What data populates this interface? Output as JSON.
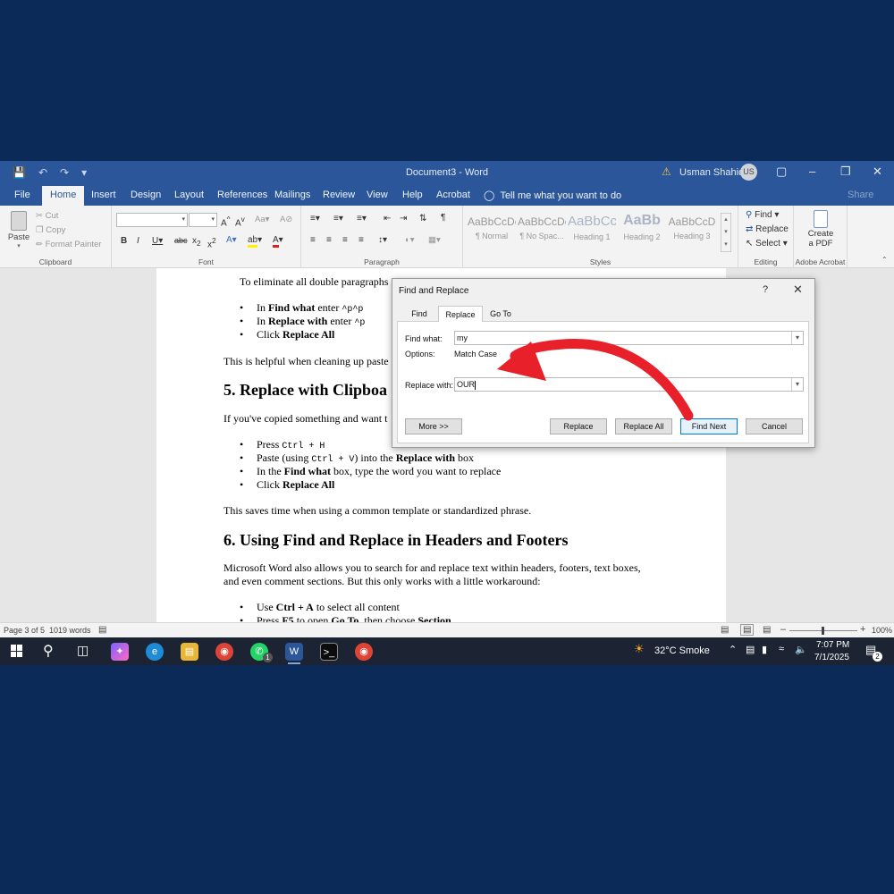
{
  "app": {
    "doc_title": "Document3 - Word",
    "user_name": "Usman Shahid",
    "user_initials": "US"
  },
  "tabs": [
    "File",
    "Home",
    "Insert",
    "Design",
    "Layout",
    "References",
    "Mailings",
    "Review",
    "View",
    "Help",
    "Acrobat"
  ],
  "tell_me": "Tell me what you want to do",
  "share": "Share",
  "ribbon": {
    "clipboard": {
      "label": "Clipboard",
      "paste": "Paste",
      "cut": "Cut",
      "copy": "Copy",
      "format_painter": "Format Painter"
    },
    "font": {
      "label": "Font"
    },
    "paragraph": {
      "label": "Paragraph"
    },
    "styles": {
      "label": "Styles",
      "items": [
        {
          "sample": "AaBbCcDc",
          "name": "¶ Normal"
        },
        {
          "sample": "AaBbCcDc",
          "name": "¶ No Spac..."
        },
        {
          "sample": "AaBbCc",
          "name": "Heading 1"
        },
        {
          "sample": "AaBb",
          "name": "Heading 2"
        },
        {
          "sample": "AaBbCcD",
          "name": "Heading 3"
        }
      ]
    },
    "editing": {
      "label": "Editing",
      "find": "Find",
      "replace": "Replace",
      "select": "Select"
    },
    "acrobat": {
      "label": "Adobe Acrobat",
      "create_pdf_1": "Create",
      "create_pdf_2": "a PDF"
    }
  },
  "document": {
    "line1": "To eliminate all double paragraphs",
    "b1_pre": "In ",
    "b1_bold": "Find what",
    "b1_post": " enter ",
    "b1_code": "^p^p",
    "b2_pre": "In ",
    "b2_bold": "Replace with",
    "b2_post": " enter ",
    "b2_code": "^p",
    "b3_pre": "Click ",
    "b3_bold": "Replace All",
    "para2": "This is helpful when cleaning up paste",
    "heading5": "5. Replace with Clipboa",
    "para3": "If you've copied something and want t",
    "c1_pre": "Press ",
    "c1_code": "Ctrl + H",
    "c2_pre": "Paste (using ",
    "c2_code": "Ctrl + V",
    "c2_mid": ") into the ",
    "c2_bold": "Replace with",
    "c2_post": " box",
    "c3_pre": "In the ",
    "c3_bold": "Find what",
    "c3_post": " box, type the word you want to replace",
    "c4_pre": "Click ",
    "c4_bold": "Replace All",
    "para4": "This saves time when using a common template or standardized phrase.",
    "heading6": "6. Using Find and Replace in Headers and Footers",
    "para5a": "Microsoft Word also allows you to search for and replace text within headers, footers, text boxes,",
    "para5b": "and even comment sections. But this only works with a little workaround:",
    "d1_pre": "Use ",
    "d1_bold": "Ctrl + A",
    "d1_post": " to select all content",
    "d2_pre": "Press ",
    "d2_bold": "F5",
    "d2_mid": " to open ",
    "d2_bold2": "Go To",
    "d2_post": ", then choose ",
    "d2_bold3": "Section"
  },
  "status": {
    "page": "Page 3 of 5",
    "words": "1019 words",
    "zoom": "100%"
  },
  "taskbar": {
    "weather": "32°C  Smoke",
    "time": "7:07 PM",
    "date": "7/1/2025",
    "notif_count": "2",
    "whatsapp_badge": "1"
  },
  "dialog": {
    "title": "Find and Replace",
    "help": "?",
    "tabs": [
      "Find",
      "Replace",
      "Go To"
    ],
    "find_label": "Find what:",
    "find_value": "my",
    "options_label": "Options:",
    "options_value": "Match Case",
    "replace_label": "Replace with:",
    "replace_value": "OUR",
    "buttons": {
      "more": "More >>",
      "replace": "Replace",
      "replace_all": "Replace All",
      "find_next": "Find Next",
      "cancel": "Cancel"
    }
  },
  "colors": {
    "word_blue": "#2b579a",
    "annotation_red": "#e8202a",
    "backdrop": "#0b2a57"
  }
}
